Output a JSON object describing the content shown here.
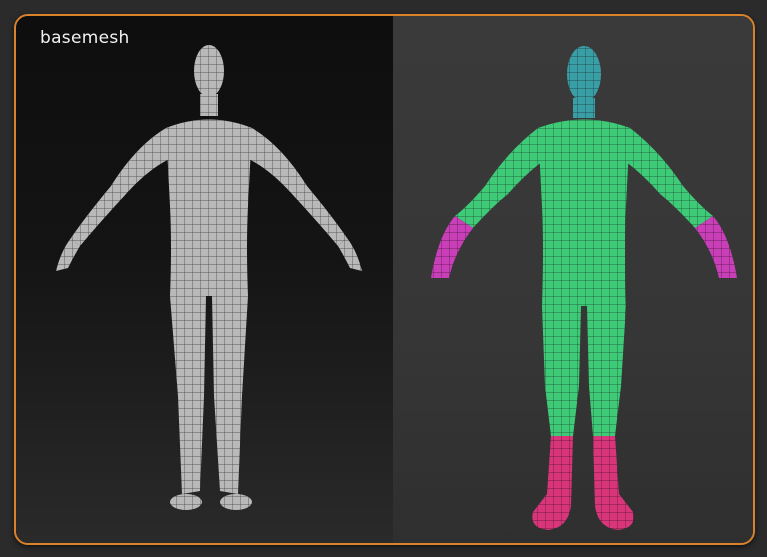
{
  "title": "basemesh",
  "colors": {
    "frame_border": "#d9822b",
    "left_mesh": "#bdbdbd",
    "head_polygroup": "#3a9ea6",
    "body_polygroup": "#3fca78",
    "hands_polygroup": "#c93fb8",
    "feet_polygroup": "#d9357a"
  },
  "panels": [
    {
      "name": "wireframe-basemesh",
      "style": "grey wireframe"
    },
    {
      "name": "polygroups-basemesh",
      "style": "colored polygroups"
    }
  ]
}
